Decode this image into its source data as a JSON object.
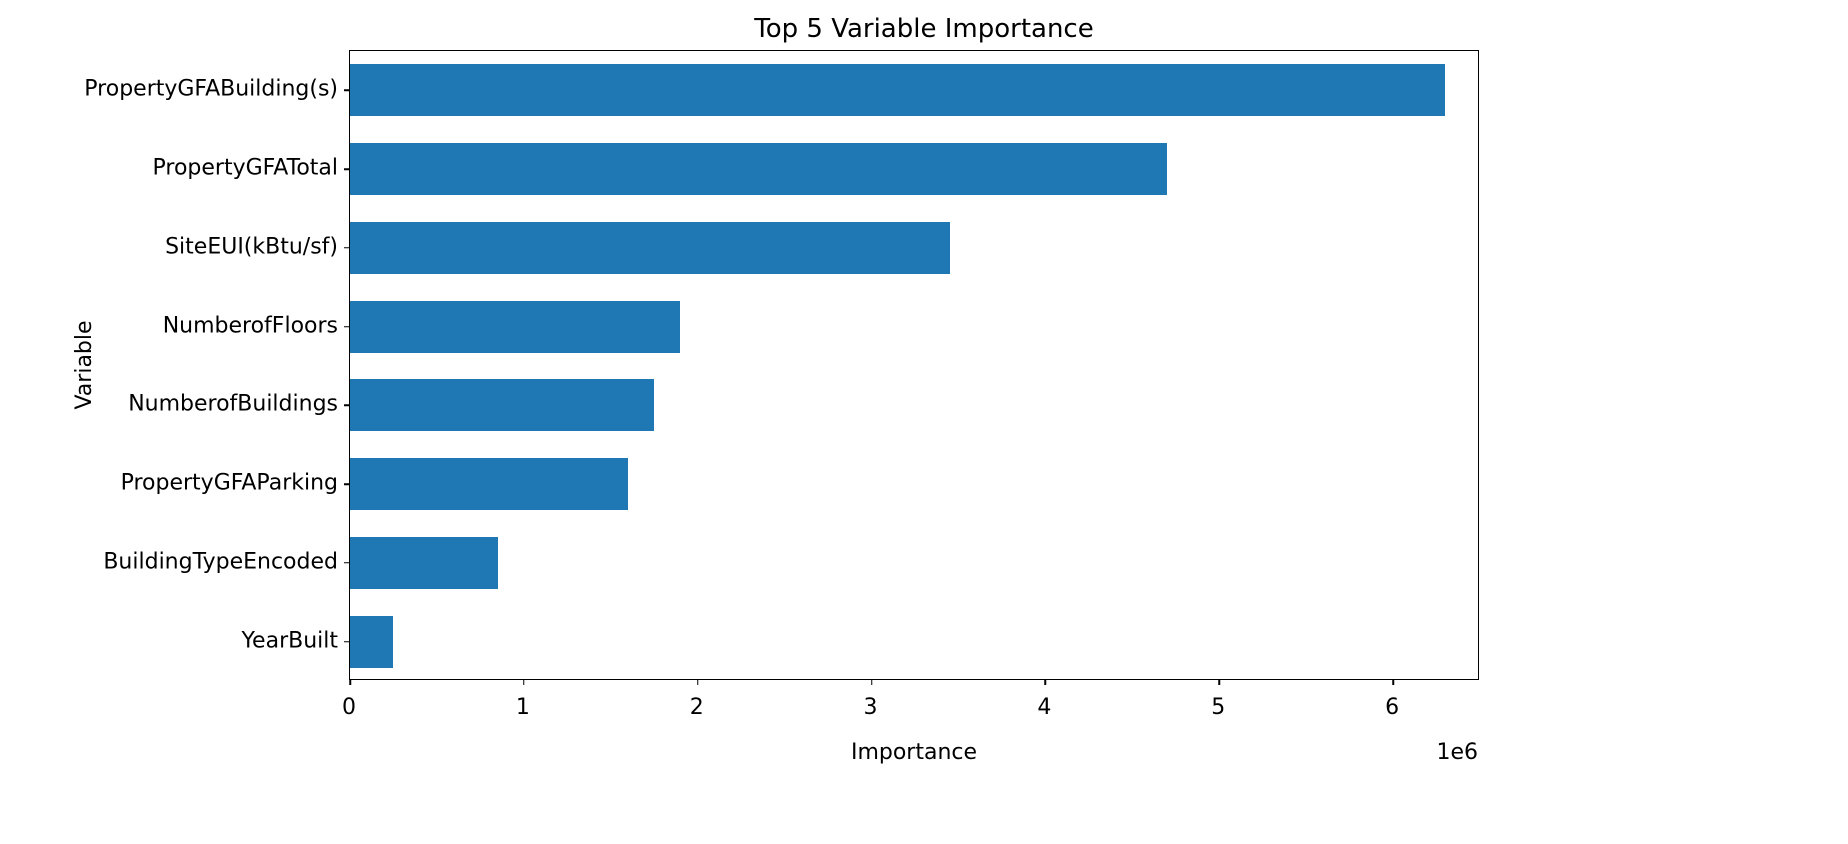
{
  "chart_data": {
    "type": "bar",
    "orientation": "horizontal",
    "title": "Top 5 Variable Importance",
    "xlabel": "Importance",
    "ylabel": "Variable",
    "xlim": [
      0,
      6500000
    ],
    "x_offset_text": "1e6",
    "x_ticks": [
      0,
      1000000,
      2000000,
      3000000,
      4000000,
      5000000,
      6000000
    ],
    "x_tick_labels": [
      "0",
      "1",
      "2",
      "3",
      "4",
      "5",
      "6"
    ],
    "categories": [
      "PropertyGFABuilding(s)",
      "PropertyGFATotal",
      "SiteEUI(kBtu/sf)",
      "NumberofFloors",
      "NumberofBuildings",
      "PropertyGFAParking",
      "BuildingTypeEncoded",
      "YearBuilt"
    ],
    "values": [
      6300000,
      4700000,
      3450000,
      1900000,
      1750000,
      1600000,
      850000,
      250000
    ],
    "bar_color": "#1f77b4"
  }
}
